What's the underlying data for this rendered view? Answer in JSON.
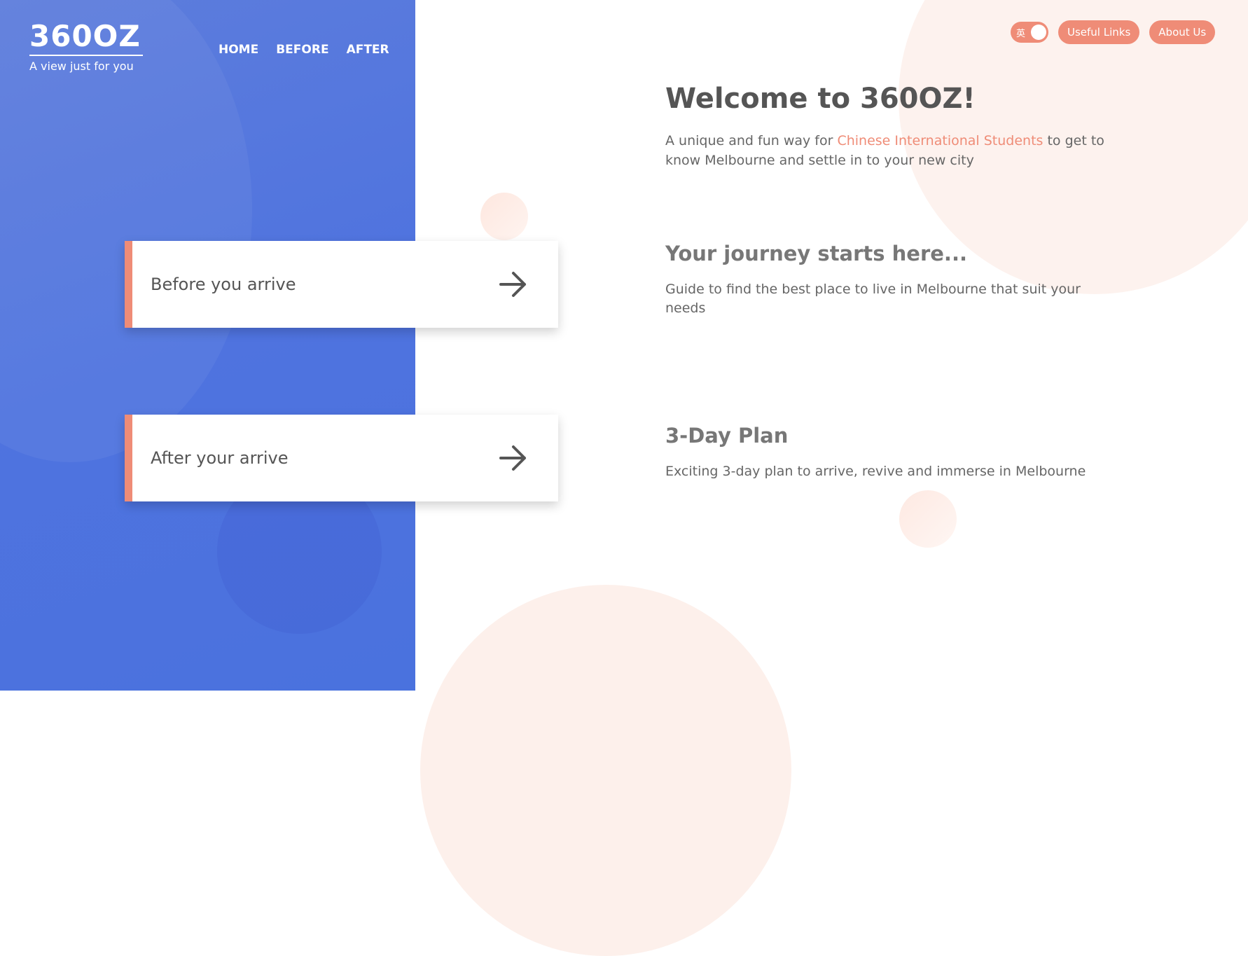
{
  "brand": {
    "logo_text": "360OZ",
    "tagline": "A view just for you"
  },
  "nav": {
    "items": [
      {
        "label": "HOME"
      },
      {
        "label": "BEFORE"
      },
      {
        "label": "AFTER"
      }
    ]
  },
  "header_controls": {
    "language_toggle_label": "英",
    "useful_links_label": "Useful Links",
    "about_us_label": "About Us"
  },
  "cards": [
    {
      "label": "Before you arrive",
      "icon": "arrow-right-icon"
    },
    {
      "label": "After your arrive",
      "icon": "arrow-right-icon"
    }
  ],
  "welcome": {
    "title": "Welcome to 360OZ!",
    "desc_prefix": "A unique and fun way for ",
    "desc_highlight": "Chinese International Students",
    "desc_suffix": " to get to know Melbourne and settle in to your new city"
  },
  "journey": {
    "title": "Your journey starts here...",
    "desc": "Guide to find the best place to live in Melbourne that suit your needs"
  },
  "plan": {
    "title": "3-Day Plan",
    "desc": "Exciting 3-day plan to arrive, revive and immerse in Melbourne"
  },
  "colors": {
    "primary_blue": "#4f73df",
    "accent_coral": "#ef8c77",
    "text_dark": "#555555"
  }
}
